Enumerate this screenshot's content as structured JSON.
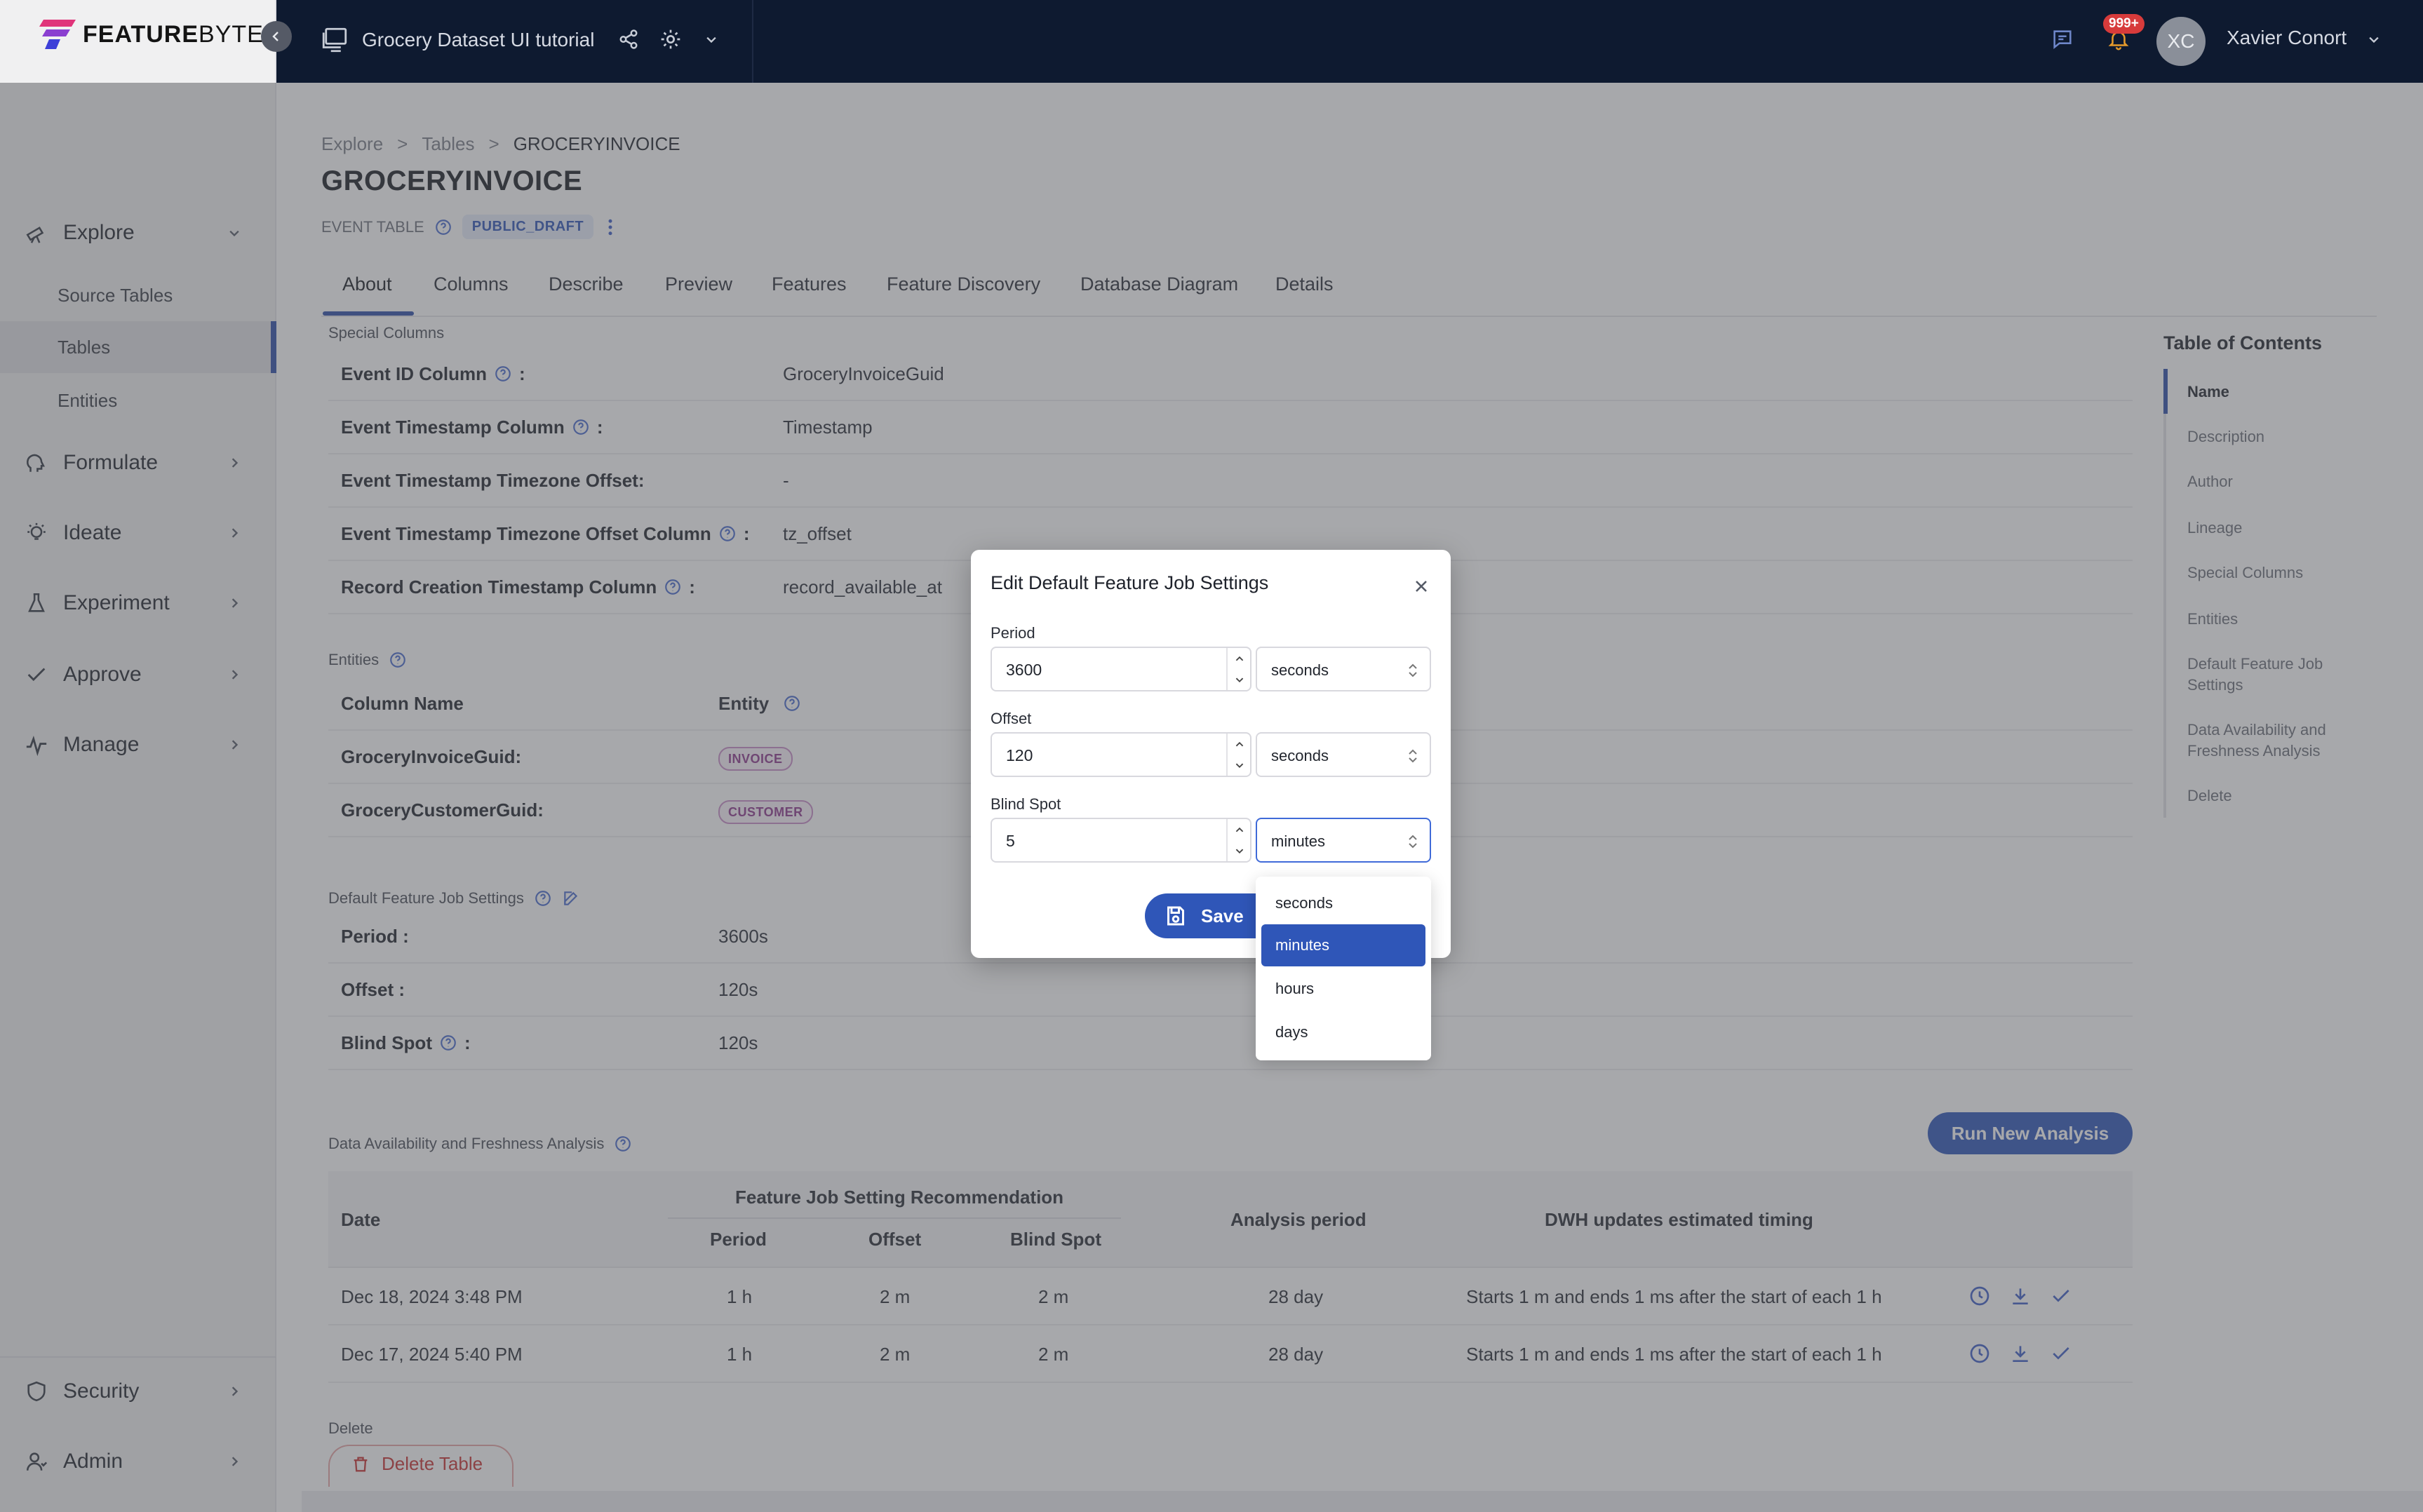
{
  "brand": {
    "name_bold": "FEATURE",
    "name_light": "BYTE"
  },
  "topbar": {
    "project_name": "Grocery Dataset UI tutorial",
    "notifications_badge": "999+",
    "user_initials": "XC",
    "user_name": "Xavier Conort"
  },
  "sidebar": {
    "explore": "Explore",
    "explore_items": [
      "Source Tables",
      "Tables",
      "Entities"
    ],
    "formulate": "Formulate",
    "ideate": "Ideate",
    "experiment": "Experiment",
    "approve": "Approve",
    "manage": "Manage",
    "security": "Security",
    "admin": "Admin"
  },
  "breadcrumb": [
    "Explore",
    ">",
    "Tables",
    ">",
    "GROCERYINVOICE"
  ],
  "page": {
    "title": "GROCERYINVOICE",
    "type_label": "EVENT TABLE",
    "status": "PUBLIC_DRAFT"
  },
  "tabs": [
    "About",
    "Columns",
    "Describe",
    "Preview",
    "Features",
    "Feature Discovery",
    "Database Diagram",
    "Details"
  ],
  "special_columns": {
    "heading": "Special Columns",
    "rows": [
      {
        "label": "Event ID Column",
        "suffix": ":",
        "value": "GroceryInvoiceGuid"
      },
      {
        "label": "Event Timestamp Column",
        "suffix": ":",
        "value": "Timestamp"
      },
      {
        "label": "Event Timestamp Timezone Offset:",
        "suffix": "",
        "value": "-"
      },
      {
        "label": "Event Timestamp Timezone Offset Column",
        "suffix": ":",
        "value": "tz_offset"
      },
      {
        "label": "Record Creation Timestamp Column",
        "suffix": ":",
        "value": "record_available_at"
      }
    ]
  },
  "entities": {
    "heading": "Entities",
    "col_name_header": "Column Name",
    "entity_header": "Entity",
    "rows": [
      {
        "column": "GroceryInvoiceGuid:",
        "entity": "INVOICE"
      },
      {
        "column": "GroceryCustomerGuid:",
        "entity": "CUSTOMER"
      }
    ]
  },
  "job_settings": {
    "heading": "Default Feature Job Settings",
    "rows": [
      {
        "label": "Period :",
        "value": "3600s"
      },
      {
        "label": "Offset :",
        "value": "120s"
      },
      {
        "label": "Blind Spot",
        "suffix": ":",
        "value": "120s"
      }
    ]
  },
  "analysis": {
    "heading": "Data Availability and Freshness Analysis",
    "run_button": "Run New Analysis",
    "headers": {
      "date": "Date",
      "group": "Feature Job Setting Recommendation",
      "period": "Period",
      "offset": "Offset",
      "blind_spot": "Blind Spot",
      "analysis_period": "Analysis period",
      "dwh": "DWH updates estimated timing"
    },
    "rows": [
      {
        "date": "Dec 18, 2024 3:48 PM",
        "period": "1 h",
        "offset": "2 m",
        "blind_spot": "2 m",
        "analysis_period": "28 day",
        "dwh": "Starts 1 m and ends 1 ms after the start of each 1 h"
      },
      {
        "date": "Dec 17, 2024 5:40 PM",
        "period": "1 h",
        "offset": "2 m",
        "blind_spot": "2 m",
        "analysis_period": "28 day",
        "dwh": "Starts 1 m and ends 1 ms after the start of each 1 h"
      }
    ]
  },
  "delete": {
    "heading": "Delete",
    "button": "Delete Table"
  },
  "toc": {
    "title": "Table of Contents",
    "items": [
      "Name",
      "Description",
      "Author",
      "Lineage",
      "Special Columns",
      "Entities",
      "Default Feature Job Settings",
      "Data Availability and Freshness Analysis",
      "Delete"
    ]
  },
  "modal": {
    "title": "Edit Default Feature Job Settings",
    "period_label": "Period",
    "period_value": "3600",
    "period_unit": "seconds",
    "offset_label": "Offset",
    "offset_value": "120",
    "offset_unit": "seconds",
    "blind_label": "Blind Spot",
    "blind_value": "5",
    "blind_unit": "minutes",
    "save_label": "Save"
  },
  "dropdown": {
    "options": [
      "seconds",
      "minutes",
      "hours",
      "days"
    ],
    "selected": "minutes"
  },
  "colors": {
    "accent": "#2f56b8",
    "topbar": "#0e1a30",
    "invoice_chip": "#8e3b8e",
    "customer_chip": "#8e3b8e"
  }
}
